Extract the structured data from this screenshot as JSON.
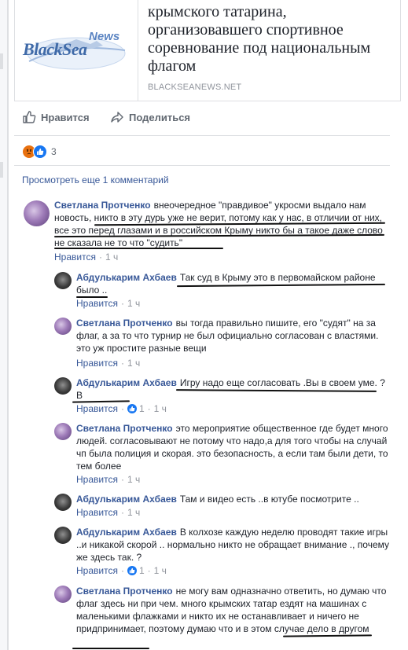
{
  "link_preview": {
    "logo_main": "BlackSea",
    "logo_news": "News",
    "title": "крымского татарина, организовавшего спортивное соревнование под национальным флагом",
    "domain": "BLACKSEANEWS.NET"
  },
  "actions": {
    "like_label": "Нравится",
    "share_label": "Поделиться",
    "like_icon": "thumbs-up-icon",
    "share_icon": "share-arrow-icon"
  },
  "reactions": {
    "types": [
      "angry",
      "like"
    ],
    "count": "3",
    "colors": {
      "like": "#1877f2",
      "angry": "#e9710f"
    }
  },
  "more_comments_label": "Просмотреть еще 1 комментарий",
  "comments": [
    {
      "author": "Светлана Протченко",
      "text": "внеочередное \"правдивое\" укросми выдало нам новость, никто в эту дурь уже не верит, потому как у нас, в отличии от них, все это перед глазами и в российском Крыму никто бы а такое даже слово не сказала не то что \"судить\"",
      "like_label": "Нравится",
      "time": "1 ч"
    }
  ],
  "replies": [
    {
      "author": "Абдулькарим Ахбаев",
      "text": "Так суд в Крыму это в первомайском районе было ..",
      "like_label": "Нравится",
      "time": "1 ч"
    },
    {
      "author": "Светлана Протченко",
      "text": "вы тогда правильно пишите, его \"судят\" на за флаг, а за то что турнир не был официально согласован с властями. это уж простите разные вещи",
      "like_label": "Нравится",
      "time": "1 ч"
    },
    {
      "author": "Абдулькарим Ахбаев",
      "text": "Игру надо еще согласовать .Вы в своем уме. ? В",
      "like_label": "Нравится",
      "likes": "1",
      "time": "1 ч"
    },
    {
      "author": "Светлана Протченко",
      "text": "это мероприятие общественное где будет много людей. согласовывают не потому что надо,а для того чтобы на случай чп была полиция и скорая. это безопасность, а если там были дети, то тем более",
      "like_label": "Нравится",
      "time": "1 ч"
    },
    {
      "author": "Абдулькарим Ахбаев",
      "text": "Там и видео есть ..в ютубе посмотрите ..",
      "like_label": "Нравится",
      "time": "1 ч"
    },
    {
      "author": "Абдулькарим Ахбаев",
      "text": "В колхозе каждую неделю проводят такие игры ..и никакой скорой .. нормально никто не обращает внимание ., почему же здесь так. ?",
      "like_label": "Нравится",
      "likes": "1",
      "time": "1 ч"
    },
    {
      "author": "Светлана Протченко",
      "text": "не могу вам одназначно ответить, но думаю что флаг здесь ни при чем. много крымских татар ездят на машинах с маленькими флажками и никто их не останавливает и ничего не придпринимает, поэтому думаю что и в этом случае дело в другом"
    }
  ]
}
